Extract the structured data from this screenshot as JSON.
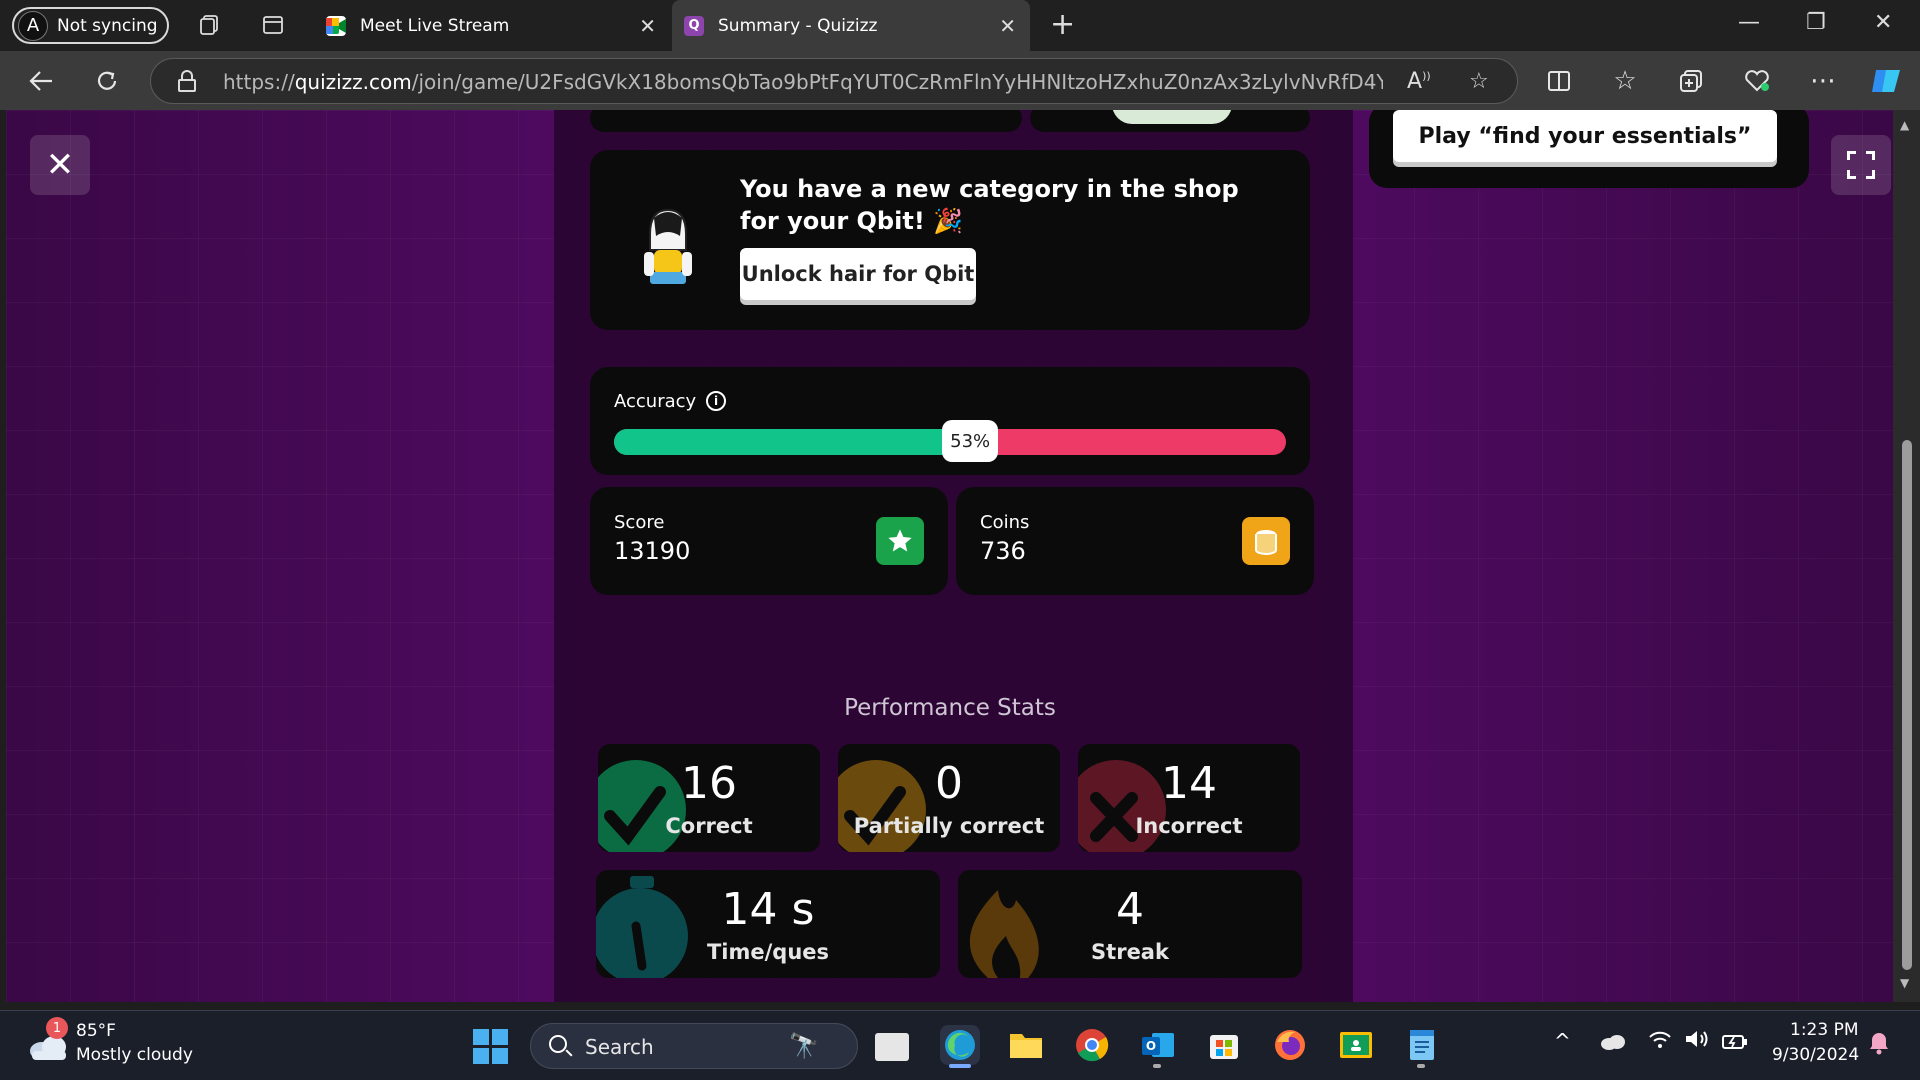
{
  "browser": {
    "profile": {
      "label": "Not syncing"
    },
    "tabs": [
      {
        "title": "Meet Live Stream",
        "active": false
      },
      {
        "title": "Summary - Quizizz",
        "active": true
      }
    ],
    "url": {
      "scheme": "https://",
      "host": "quizizz.com",
      "path": "/join/game/U2FsdGVkX18bomsQbTao9bPtFqYUT0CzRmFlnYyHHNItzoHZxhuZ0nzAx3zLylvNvRfD4Ybsfb0..."
    }
  },
  "page": {
    "play_button_label": "Play “find your essentials”",
    "qbit": {
      "message": "You have a new category in the shop for your Qbit! 🎉",
      "unlock_label": "Unlock hair for Qbit"
    },
    "accuracy": {
      "label": "Accuracy",
      "info_symbol": "i",
      "value": 53,
      "display": "53%"
    },
    "score": {
      "label": "Score",
      "value": "13190"
    },
    "coins": {
      "label": "Coins",
      "value": "736"
    },
    "performance": {
      "title": "Performance Stats",
      "stats": [
        {
          "value": "16",
          "label": "Correct"
        },
        {
          "value": "0",
          "label": "Partially correct"
        },
        {
          "value": "14",
          "label": "Incorrect"
        },
        {
          "value": "14 s",
          "label": "Time/ques"
        },
        {
          "value": "4",
          "label": "Streak"
        }
      ]
    }
  },
  "taskbar": {
    "weather": {
      "badge": "1",
      "temp": "85°F",
      "desc": "Mostly cloudy"
    },
    "search_label": "Search",
    "clock": {
      "time": "1:23 PM",
      "date": "9/30/2024"
    }
  },
  "colors": {
    "correct": "#10c48a",
    "incorrect": "#ee3a66",
    "score_badge": "#1aa34a",
    "coins_badge": "#f0a417",
    "page_purple": "#5a0c6c"
  },
  "icons": [
    "close-icon",
    "fullscreen-icon",
    "info-icon",
    "star-icon",
    "coins-icon",
    "check-icon",
    "x-icon",
    "stopwatch-icon",
    "flame-icon"
  ]
}
